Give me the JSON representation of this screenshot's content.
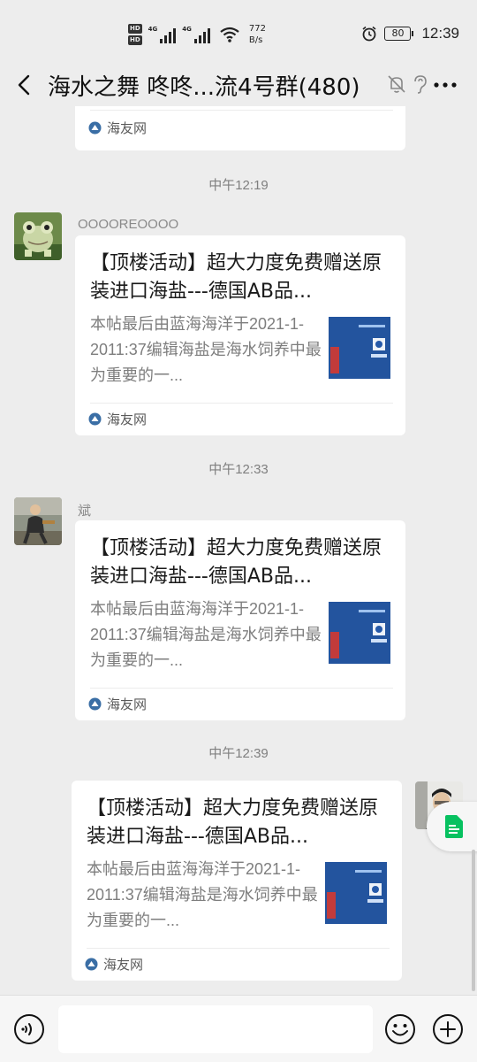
{
  "status_bar": {
    "hd_badges": [
      "HD",
      "HD"
    ],
    "signal_labels": [
      "4G",
      "4G"
    ],
    "net_speed_value": "772",
    "net_speed_unit": "B/s",
    "battery": "80",
    "clock": "12:39"
  },
  "header": {
    "title": "海水之舞 咚咚...流4号群(480)",
    "icons": [
      "back-arrow-icon",
      "mute-bell-icon",
      "earpiece-icon",
      "more-icon"
    ]
  },
  "messages": [
    {
      "kind": "continuation",
      "source": "海友网"
    },
    {
      "kind": "timestamp",
      "text": "中午12:19"
    },
    {
      "kind": "link",
      "side": "left",
      "sender": "OOOOREOOOO",
      "title": "【顶楼活动】超大力度免费赠送原装进口海盐---德国AB品...",
      "desc": "本帖最后由蓝海海洋于2021-1-2011:37编辑海盐是海水饲养中最为重要的一...",
      "source": "海友网"
    },
    {
      "kind": "timestamp",
      "text": "中午12:33"
    },
    {
      "kind": "link",
      "side": "left",
      "sender": "斌",
      "title": "【顶楼活动】超大力度免费赠送原装进口海盐---德国AB品...",
      "desc": "本帖最后由蓝海海洋于2021-1-2011:37编辑海盐是海水饲养中最为重要的一...",
      "source": "海友网"
    },
    {
      "kind": "timestamp",
      "text": "中午12:39"
    },
    {
      "kind": "link",
      "side": "right",
      "sender": "",
      "title": "【顶楼活动】超大力度免费赠送原装进口海盐---德国AB品...",
      "desc": "本帖最后由蓝海海洋于2021-1-2011:37编辑海盐是海水饲养中最为重要的一...",
      "source": "海友网"
    }
  ],
  "input_bar": {
    "placeholder": "",
    "icons": [
      "voice-icon",
      "emoji-icon",
      "plus-icon"
    ]
  },
  "colors": {
    "background": "#ededed",
    "card": "#ffffff",
    "accent_green": "#07c160",
    "timestamp": "#7f7f7f"
  }
}
